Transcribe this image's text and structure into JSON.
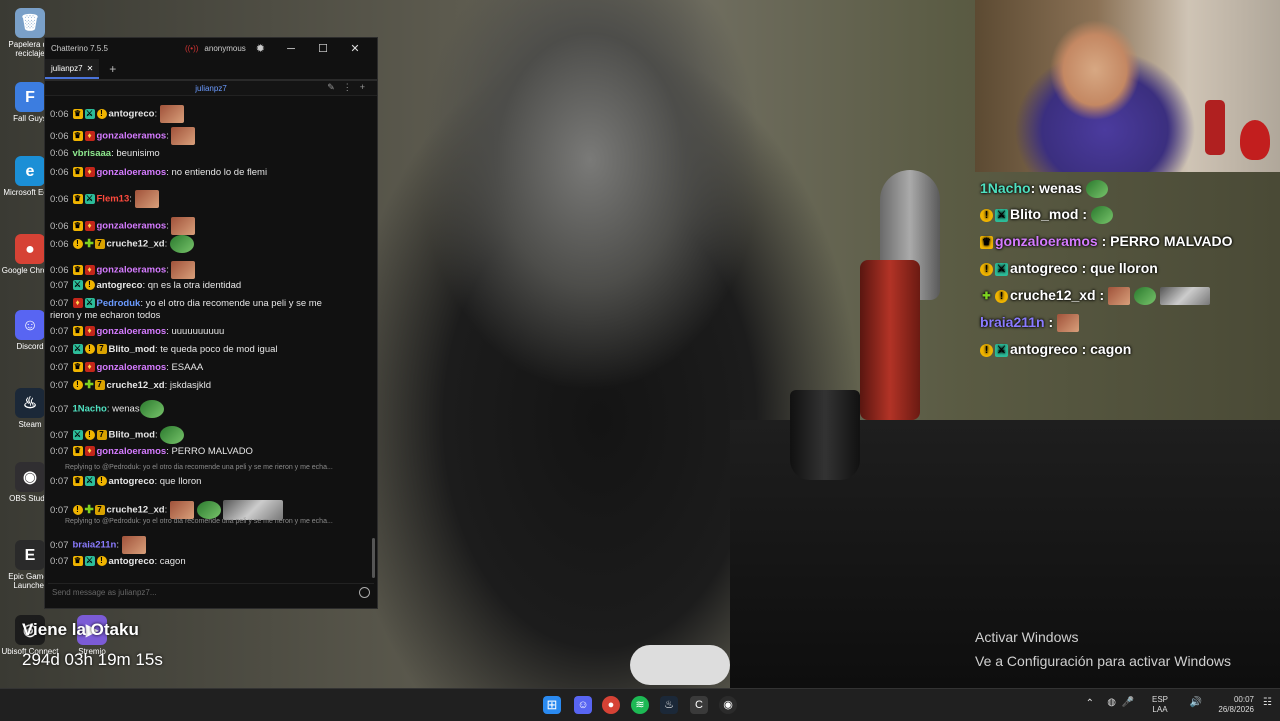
{
  "desktop": {
    "icons": [
      {
        "label": "Papelera de reciclaje",
        "color": "#7aa0c8",
        "glyph": "🗑"
      },
      {
        "label": "Fall Guys",
        "color": "#3c7de0",
        "glyph": "F"
      },
      {
        "label": "Microsoft Edge",
        "color": "#1b8fd6",
        "glyph": "e"
      },
      {
        "label": "Google Chrome",
        "color": "#d64235",
        "glyph": "●"
      },
      {
        "label": "Discord",
        "color": "#5865f2",
        "glyph": "☺"
      },
      {
        "label": "Steam",
        "color": "#1b2838",
        "glyph": "♨"
      },
      {
        "label": "OBS Studio",
        "color": "#302e31",
        "glyph": "◉"
      },
      {
        "label": "Epic Games Launcher",
        "color": "#2a2a2a",
        "glyph": "E"
      },
      {
        "label": "Ubisoft Connect",
        "color": "#1c1c1c",
        "glyph": "◎"
      },
      {
        "label": "Stremio",
        "color": "#7b5bd6",
        "glyph": "▶"
      }
    ]
  },
  "chatterino": {
    "title": "Chatterino 7.5.5",
    "user": "anonymous",
    "tab": "julianpz7",
    "channel": "julianpz7",
    "input_placeholder": "Send message as julianpz7...",
    "messages": [
      {
        "time": "0:06",
        "badges": [
          "crown",
          "mod",
          "coin"
        ],
        "user": "antogreco",
        "color": "#e6e6e6",
        "text": "",
        "emotes": [
          "face"
        ]
      },
      {
        "time": "0:06",
        "badges": [
          "crown",
          "vip"
        ],
        "user": "gonzaloeramos",
        "color": "#d57bff",
        "text": "",
        "emotes": [
          "face"
        ]
      },
      {
        "time": "0:06",
        "badges": [],
        "user": "vbrisaaa",
        "color": "#8ee88e",
        "text": "beunisimo",
        "emotes": []
      },
      {
        "time": "0:06",
        "badges": [
          "crown",
          "vip"
        ],
        "user": "gonzaloeramos",
        "color": "#d57bff",
        "text": "no entiendo lo de flemi",
        "emotes": []
      },
      {
        "time": "0:06",
        "badges": [
          "crown",
          "mod"
        ],
        "user": "Flem13",
        "color": "#ff4a3d",
        "text": "",
        "emotes": [
          "face"
        ]
      },
      {
        "time": "0:06",
        "badges": [
          "crown",
          "vip"
        ],
        "user": "gonzaloeramos",
        "color": "#d57bff",
        "text": "",
        "emotes": [
          "face"
        ]
      },
      {
        "time": "0:06",
        "badges": [
          "coin",
          "plus",
          "sub"
        ],
        "user": "cruche12_xd",
        "color": "#e6e6e6",
        "text": "",
        "emotes": [
          "green"
        ]
      },
      {
        "time": "0:06",
        "badges": [
          "crown",
          "vip"
        ],
        "user": "gonzaloeramos",
        "color": "#d57bff",
        "text": "",
        "emotes": [
          "face"
        ]
      },
      {
        "time": "0:07",
        "badges": [
          "mod",
          "coin"
        ],
        "user": "antogreco",
        "color": "#e6e6e6",
        "text": "qn es la otra identidad",
        "emotes": []
      },
      {
        "time": "0:07",
        "badges": [
          "vip",
          "mod"
        ],
        "user": "Pedroduk",
        "color": "#6b9bff",
        "text": "yo el otro dia recomende una peli y se me",
        "text2": "rieron y me echaron todos",
        "emotes": []
      },
      {
        "time": "0:07",
        "badges": [
          "crown",
          "vip"
        ],
        "user": "gonzaloeramos",
        "color": "#d57bff",
        "text": "uuuuuuuuuu",
        "emotes": []
      },
      {
        "time": "0:07",
        "badges": [
          "mod",
          "coin",
          "sub"
        ],
        "user": "Blito_mod",
        "color": "#e6e6e6",
        "text": "te queda poco de mod igual",
        "emotes": []
      },
      {
        "time": "0:07",
        "badges": [
          "crown",
          "vip"
        ],
        "user": "gonzaloeramos",
        "color": "#d57bff",
        "text": "ESAAA",
        "emotes": []
      },
      {
        "time": "0:07",
        "badges": [
          "coin",
          "plus",
          "sub"
        ],
        "user": "cruche12_xd",
        "color": "#e6e6e6",
        "text": "jskdasjkld",
        "emotes": []
      },
      {
        "time": "0:07",
        "badges": [],
        "user": "1Nacho",
        "color": "#4fe0c0",
        "text": "wenas",
        "emotes": [
          "green"
        ]
      },
      {
        "time": "0:07",
        "badges": [
          "mod",
          "coin",
          "sub"
        ],
        "user": "Blito_mod",
        "color": "#e6e6e6",
        "text": "",
        "emotes": [
          "green"
        ]
      },
      {
        "time": "0:07",
        "badges": [
          "crown",
          "vip"
        ],
        "user": "gonzaloeramos",
        "color": "#d57bff",
        "text": "PERRO MALVADO",
        "emotes": []
      },
      {
        "reply": "Replying to @Pedroduk: yo el otro dia recomende una peli y se me rieron y me echa..."
      },
      {
        "time": "0:07",
        "badges": [
          "crown",
          "mod",
          "coin"
        ],
        "user": "antogreco",
        "color": "#e6e6e6",
        "text": "que lloron",
        "emotes": []
      },
      {
        "time": "0:07",
        "badges": [
          "coin",
          "plus",
          "sub"
        ],
        "user": "cruche12_xd",
        "color": "#e6e6e6",
        "text": "",
        "emotes": [
          "face",
          "green",
          "gray"
        ]
      },
      {
        "reply": "Replying to @Pedroduk: yo el otro dia recomende una peli y se me rieron y me echa..."
      },
      {
        "time": "0:07",
        "badges": [],
        "user": "braia211n",
        "color": "#8a7bff",
        "text": "",
        "emotes": [
          "face"
        ]
      },
      {
        "time": "0:07",
        "badges": [
          "crown",
          "mod",
          "coin"
        ],
        "user": "antogreco",
        "color": "#e6e6e6",
        "text": "cagon",
        "emotes": []
      }
    ]
  },
  "overlay": {
    "lines": [
      {
        "badges": [],
        "user": "1Nacho",
        "color": "#4fe0c0",
        "text": ": wenas",
        "emotes": [
          "green"
        ]
      },
      {
        "badges": [
          "coin",
          "mod"
        ],
        "user": "Blito_mod",
        "color": "#ffffff",
        "text": " :",
        "emotes": [
          "green"
        ]
      },
      {
        "badges": [
          "crown"
        ],
        "user": "gonzaloeramos",
        "color": "#d57bff",
        "text": " : PERRO MALVADO",
        "emotes": []
      },
      {
        "badges": [
          "coin",
          "mod"
        ],
        "user": "antogreco",
        "color": "#ffffff",
        "text": " : que lloron",
        "emotes": []
      },
      {
        "badges": [
          "plus",
          "coin"
        ],
        "user": "cruche12_xd",
        "color": "#ffffff",
        "text": " :",
        "emotes": [
          "face",
          "green",
          "gray"
        ]
      },
      {
        "badges": [],
        "user": "braia211n",
        "color": "#8a7bff",
        "text": " :",
        "emotes": [
          "face"
        ]
      },
      {
        "badges": [
          "coin",
          "mod"
        ],
        "user": "antogreco",
        "color": "#ffffff",
        "text": " : cagon",
        "emotes": []
      }
    ]
  },
  "stream": {
    "otaku": "Viene la Otaku",
    "timer": "294d 03h 19m 15s"
  },
  "activate": {
    "line1": "Activar Windows",
    "line2": "Ve a Configuración para activar Windows"
  },
  "taskbar": {
    "lang1": "ESP",
    "lang2": "LAA",
    "time": "00:07",
    "date": "26/8/2026"
  }
}
